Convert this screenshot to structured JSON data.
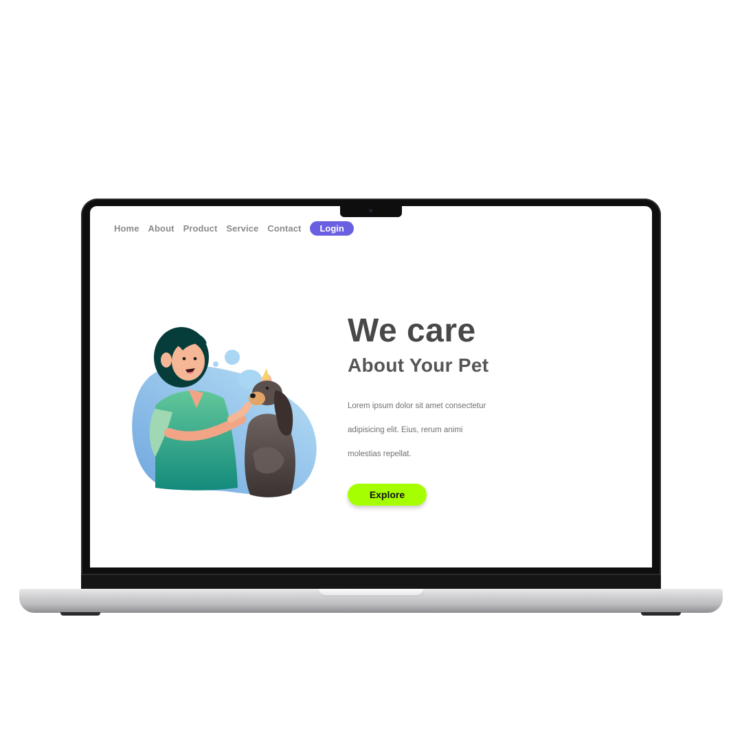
{
  "nav": {
    "items": [
      "Home",
      "About",
      "Product",
      "Service",
      "Contact"
    ],
    "login_label": "Login"
  },
  "hero": {
    "title": "We care",
    "subtitle": "About Your Pet",
    "description_lines": [
      "Lorem ipsum dolor sit amet consectetur",
      "adipisicing elit. Eius, rerum animi",
      "molestias repellat."
    ],
    "cta_label": "Explore"
  },
  "colors": {
    "login_accent": "#6a5fe0",
    "cta_accent": "#a6ff00",
    "title_text": "#484848",
    "illustration_blob": "#8cc6ee",
    "shirt": "#3fb38a"
  },
  "illustration": {
    "subject": "woman-grooming-dog-illustration"
  }
}
